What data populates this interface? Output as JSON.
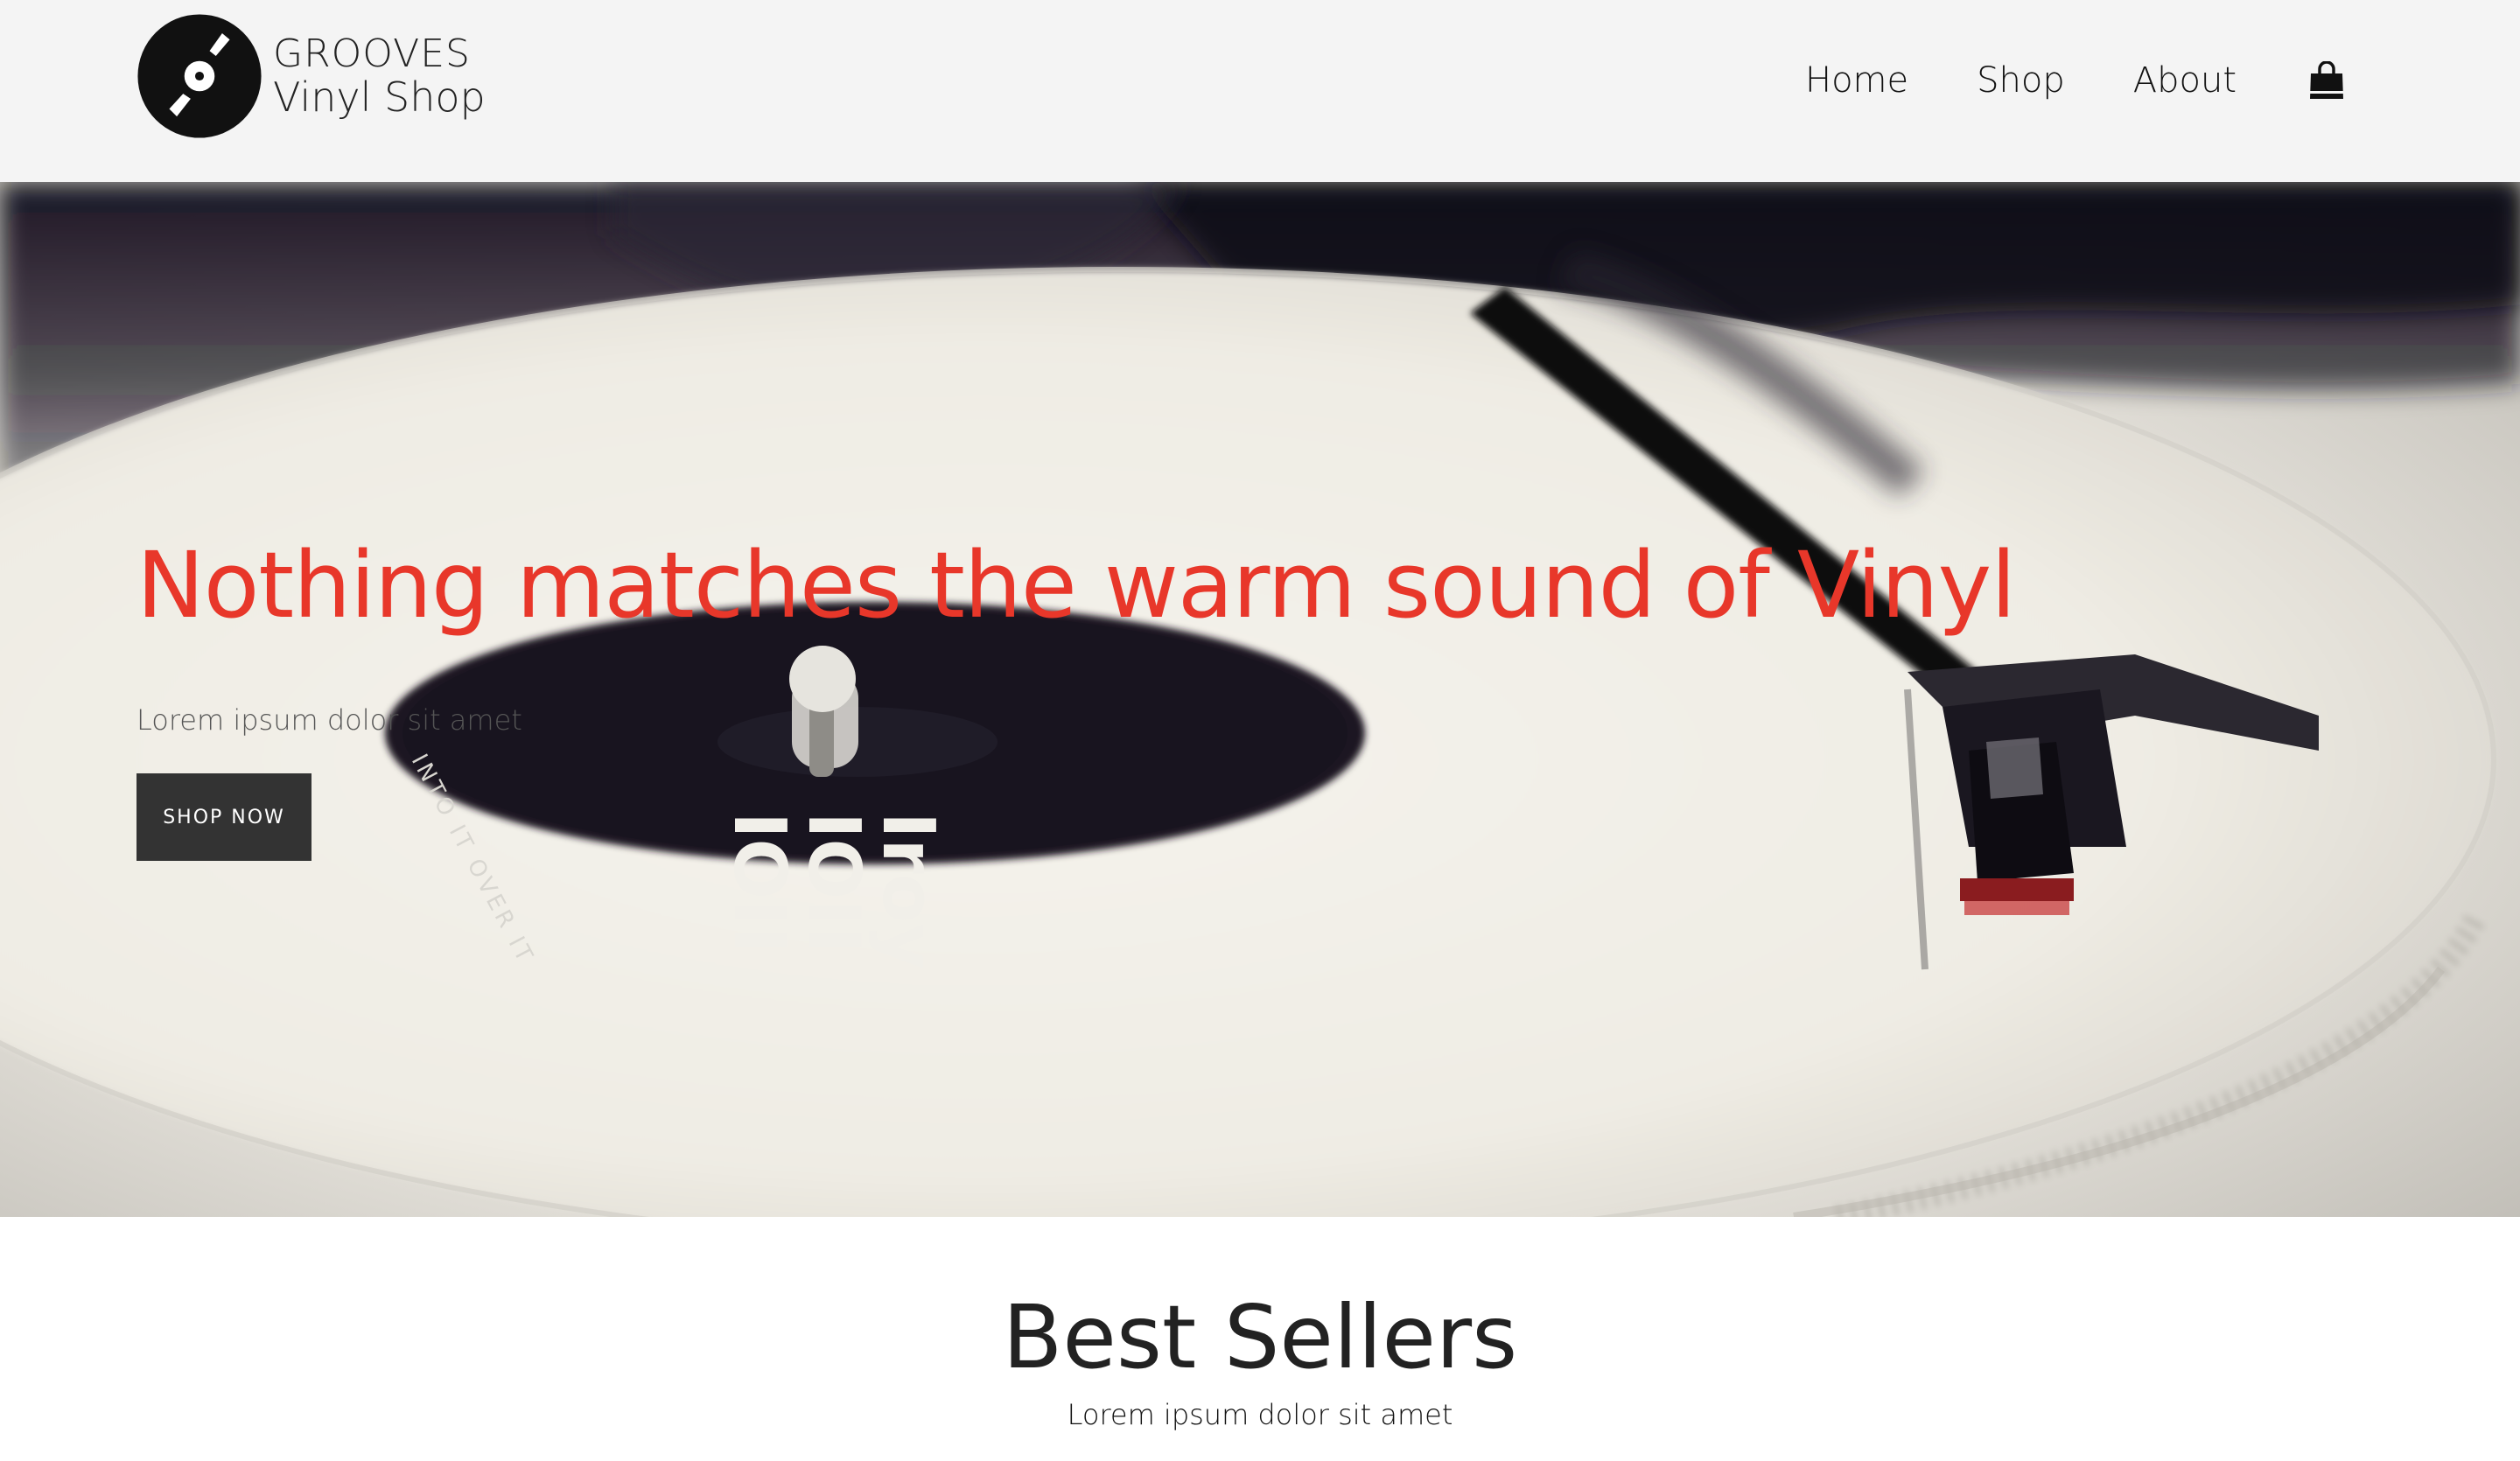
{
  "brand": {
    "name_line1": "GROOVES",
    "name_line2": "Vinyl Shop",
    "logo_icon": "vinyl-record-icon"
  },
  "nav": {
    "items": [
      {
        "label": "Home"
      },
      {
        "label": "Shop"
      },
      {
        "label": "About"
      }
    ],
    "cart_icon": "shopping-bag-icon"
  },
  "hero": {
    "headline": "Nothing matches the warm sound of Vinyl",
    "subheadline": "Lorem ipsum dolor sit amet",
    "cta_label": "SHOP NOW",
    "record_label_lines": [
      "Iroy",
      "IOII",
      "IOII"
    ],
    "record_label_ring_text": "INTO IT OVER IT"
  },
  "best_sellers": {
    "title": "Best Sellers",
    "subtitle": "Lorem ipsum dolor sit amet"
  },
  "colors": {
    "header_bg": "#f4f4f4",
    "headline_red": "#e8372a",
    "cta_bg": "#333333",
    "text_dark": "#222222"
  }
}
